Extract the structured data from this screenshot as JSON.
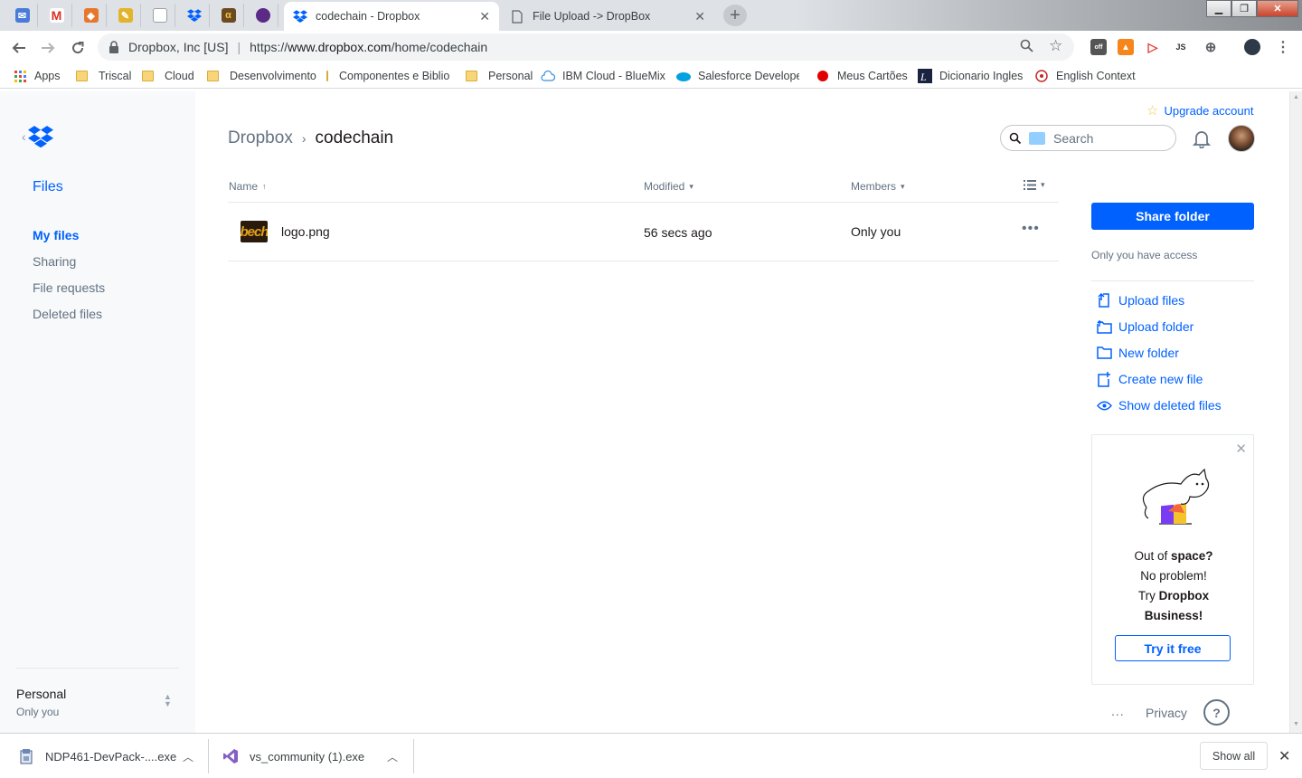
{
  "browser": {
    "pinned_tabs": [
      {
        "icon": "inbox-icon",
        "color": "#4a7bd8"
      },
      {
        "icon": "gmail-icon",
        "color": "#d93025"
      },
      {
        "icon": "package-icon",
        "color": "#e8772e"
      },
      {
        "icon": "notes-icon",
        "color": "#e2b42b"
      },
      {
        "icon": "document-icon",
        "color": "#9aa0a6"
      },
      {
        "icon": "dropbox-icon",
        "color": "#0061fe"
      },
      {
        "icon": "app-icon",
        "color": "#6b4a1f"
      },
      {
        "icon": "circle-icon",
        "color": "#5b2a86"
      }
    ],
    "tabs": [
      {
        "title": "codechain - Dropbox",
        "active": true
      },
      {
        "title": "File Upload -> DropBox",
        "active": false
      }
    ],
    "address": {
      "org": "Dropbox, Inc [US]",
      "url_prefix": "https://",
      "url_host": "www.dropbox.com",
      "url_path": "/home/codechain"
    },
    "bookmarks": [
      {
        "label": "Apps",
        "icon": "apps-grid-icon"
      },
      {
        "label": "Triscal",
        "icon": "folder-icon"
      },
      {
        "label": "Cloud",
        "icon": "folder-icon"
      },
      {
        "label": "Desenvolvimento",
        "icon": "folder-icon"
      },
      {
        "label": "Componentes e Biblio",
        "icon": "folder-icon"
      },
      {
        "label": "Personal",
        "icon": "folder-icon"
      },
      {
        "label": "IBM Cloud - BlueMix",
        "icon": "cloud-icon"
      },
      {
        "label": "Salesforce Developer",
        "icon": "salesforce-icon"
      },
      {
        "label": "Meus Cartões",
        "icon": "red-dot-icon"
      },
      {
        "label": "Dicionario Ingles",
        "icon": "dictionary-icon"
      },
      {
        "label": "English Context",
        "icon": "context-icon"
      }
    ]
  },
  "sidebar": {
    "section": "Files",
    "items": [
      {
        "label": "My files",
        "active": true
      },
      {
        "label": "Sharing",
        "active": false
      },
      {
        "label": "File requests",
        "active": false
      },
      {
        "label": "Deleted files",
        "active": false
      }
    ],
    "plan": "Personal",
    "plan_sub": "Only you"
  },
  "header": {
    "upgrade": "Upgrade account",
    "breadcrumb_root": "Dropbox",
    "breadcrumb_current": "codechain",
    "search_placeholder": "Search"
  },
  "table": {
    "columns": {
      "name": "Name",
      "modified": "Modified",
      "members": "Members"
    },
    "rows": [
      {
        "thumb_text": "bech",
        "name": "logo.png",
        "modified": "56 secs ago",
        "members": "Only you"
      }
    ]
  },
  "right_panel": {
    "share_button": "Share folder",
    "access_text": "Only you have access",
    "actions": [
      {
        "label": "Upload files",
        "icon": "upload-files-icon"
      },
      {
        "label": "Upload folder",
        "icon": "upload-folder-icon"
      },
      {
        "label": "New folder",
        "icon": "new-folder-icon"
      },
      {
        "label": "Create new file",
        "icon": "create-file-icon"
      },
      {
        "label": "Show deleted files",
        "icon": "eye-icon"
      }
    ],
    "promo": {
      "line1a": "Out of ",
      "line1b": "space?",
      "line2": "No problem!",
      "line3a": "Try ",
      "line3b": "Dropbox",
      "line4": "Business!",
      "button": "Try it free"
    },
    "footer": {
      "more": "...",
      "privacy": "Privacy",
      "help": "?"
    }
  },
  "downloads": {
    "items": [
      {
        "name": "NDP461-DevPack-....exe",
        "icon": "installer-icon"
      },
      {
        "name": "vs_community (1).exe",
        "icon": "visual-studio-icon"
      }
    ],
    "show_all": "Show all"
  },
  "colors": {
    "accent": "#0061fe",
    "sidebar_bg": "#f7f9fa",
    "muted_text": "#637282"
  }
}
